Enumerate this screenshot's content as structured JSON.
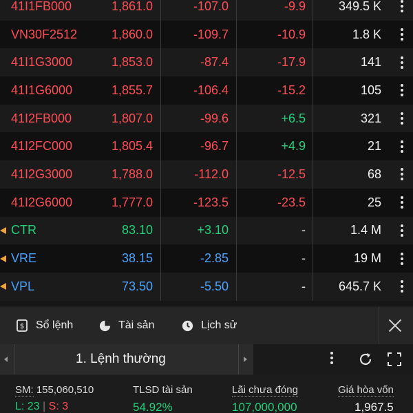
{
  "rows": [
    {
      "symbol": "41I1FB000",
      "price": "1,861.0",
      "change": "-107.0",
      "pct": "-9.9",
      "vol": "349.5 K",
      "symColor": "sym-red",
      "priceColor": "red",
      "chgColor": "red",
      "pctColor": "red",
      "flag": false
    },
    {
      "symbol": "VN30F2512",
      "price": "1,860.0",
      "change": "-109.7",
      "pct": "-10.9",
      "vol": "1.8 K",
      "symColor": "sym-red",
      "priceColor": "red",
      "chgColor": "red",
      "pctColor": "red",
      "flag": false
    },
    {
      "symbol": "41I1G3000",
      "price": "1,853.0",
      "change": "-87.4",
      "pct": "-17.9",
      "vol": "141",
      "symColor": "sym-red",
      "priceColor": "red",
      "chgColor": "red",
      "pctColor": "red",
      "flag": false
    },
    {
      "symbol": "41I1G6000",
      "price": "1,855.7",
      "change": "-106.4",
      "pct": "-15.2",
      "vol": "105",
      "symColor": "sym-red",
      "priceColor": "red",
      "chgColor": "red",
      "pctColor": "red",
      "flag": false
    },
    {
      "symbol": "41I2FB000",
      "price": "1,807.0",
      "change": "-99.6",
      "pct": "+6.5",
      "vol": "321",
      "symColor": "sym-red",
      "priceColor": "red",
      "chgColor": "red",
      "pctColor": "green",
      "flag": false
    },
    {
      "symbol": "41I2FC000",
      "price": "1,805.4",
      "change": "-96.7",
      "pct": "+4.9",
      "vol": "21",
      "symColor": "sym-red",
      "priceColor": "red",
      "chgColor": "red",
      "pctColor": "green",
      "flag": false
    },
    {
      "symbol": "41I2G3000",
      "price": "1,788.0",
      "change": "-112.0",
      "pct": "-12.5",
      "vol": "68",
      "symColor": "sym-red",
      "priceColor": "red",
      "chgColor": "red",
      "pctColor": "red",
      "flag": false
    },
    {
      "symbol": "41I2G6000",
      "price": "1,777.0",
      "change": "-123.5",
      "pct": "-23.5",
      "vol": "25",
      "symColor": "sym-red",
      "priceColor": "red",
      "chgColor": "red",
      "pctColor": "red",
      "flag": false
    },
    {
      "symbol": "CTR",
      "price": "83.10",
      "change": "+3.10",
      "pct": "-",
      "vol": "1.4 M",
      "symColor": "green",
      "priceColor": "green",
      "chgColor": "green",
      "pctColor": "white",
      "flag": true
    },
    {
      "symbol": "VRE",
      "price": "38.15",
      "change": "-2.85",
      "pct": "-",
      "vol": "19 M",
      "symColor": "blue",
      "priceColor": "blue",
      "chgColor": "blue",
      "pctColor": "white",
      "flag": true
    },
    {
      "symbol": "VPL",
      "price": "73.50",
      "change": "-5.50",
      "pct": "-",
      "vol": "645.7 K",
      "symColor": "blue",
      "priceColor": "blue",
      "chgColor": "blue",
      "pctColor": "white",
      "flag": true
    }
  ],
  "tabs": {
    "orders": "Sổ lệnh",
    "assets": "Tài sản",
    "history": "Lịch sử"
  },
  "order_type": "1. Lệnh thường",
  "summary": {
    "sm_label": "SM:",
    "sm_value": "155,060,510",
    "long_label": "L: 23",
    "short_label": "S: 3",
    "tlsd_label": "TLSD tài sản",
    "tlsd_value": "54.92%",
    "pnl_label": "Lãi chưa đóng",
    "pnl_value": "107,000,000",
    "breakeven_label": "Giá hòa vốn",
    "breakeven_value": "1,967.5"
  },
  "colors": {
    "red": "#ff4d55",
    "green": "#21d07a",
    "blue": "#4aa3ff",
    "flag": "#f2a23a"
  }
}
